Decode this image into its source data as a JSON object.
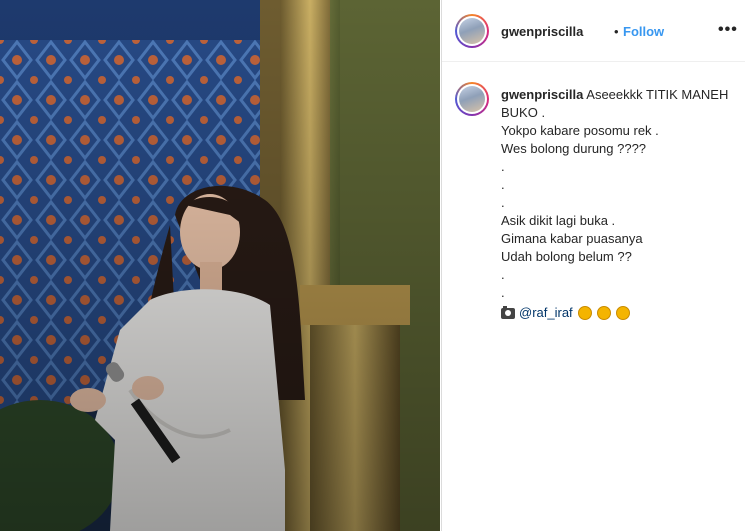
{
  "header": {
    "username": "gwenpriscilla",
    "separator": "•",
    "follow_label": "Follow",
    "more_icon": "more-options-icon"
  },
  "caption": {
    "username": "gwenpriscilla",
    "first_line": "Aseeekkk TITIK MANEH",
    "lines": [
      "BUKO .",
      "Yokpo kabare posomu rek .",
      "Wes bolong durung ????",
      ".",
      ".",
      ".",
      "Asik dikit lagi buka .",
      "Gimana kabar puasanya",
      "Udah bolong belum ??",
      ".",
      "."
    ],
    "camera_icon": "camera-icon",
    "mention": "@raf_iraf",
    "clap_icons": [
      "clap-icon",
      "clap-icon",
      "clap-icon"
    ]
  },
  "colors": {
    "follow": "#3897f0",
    "text": "#262626",
    "mention": "#003569",
    "border": "#dbdbdb"
  }
}
